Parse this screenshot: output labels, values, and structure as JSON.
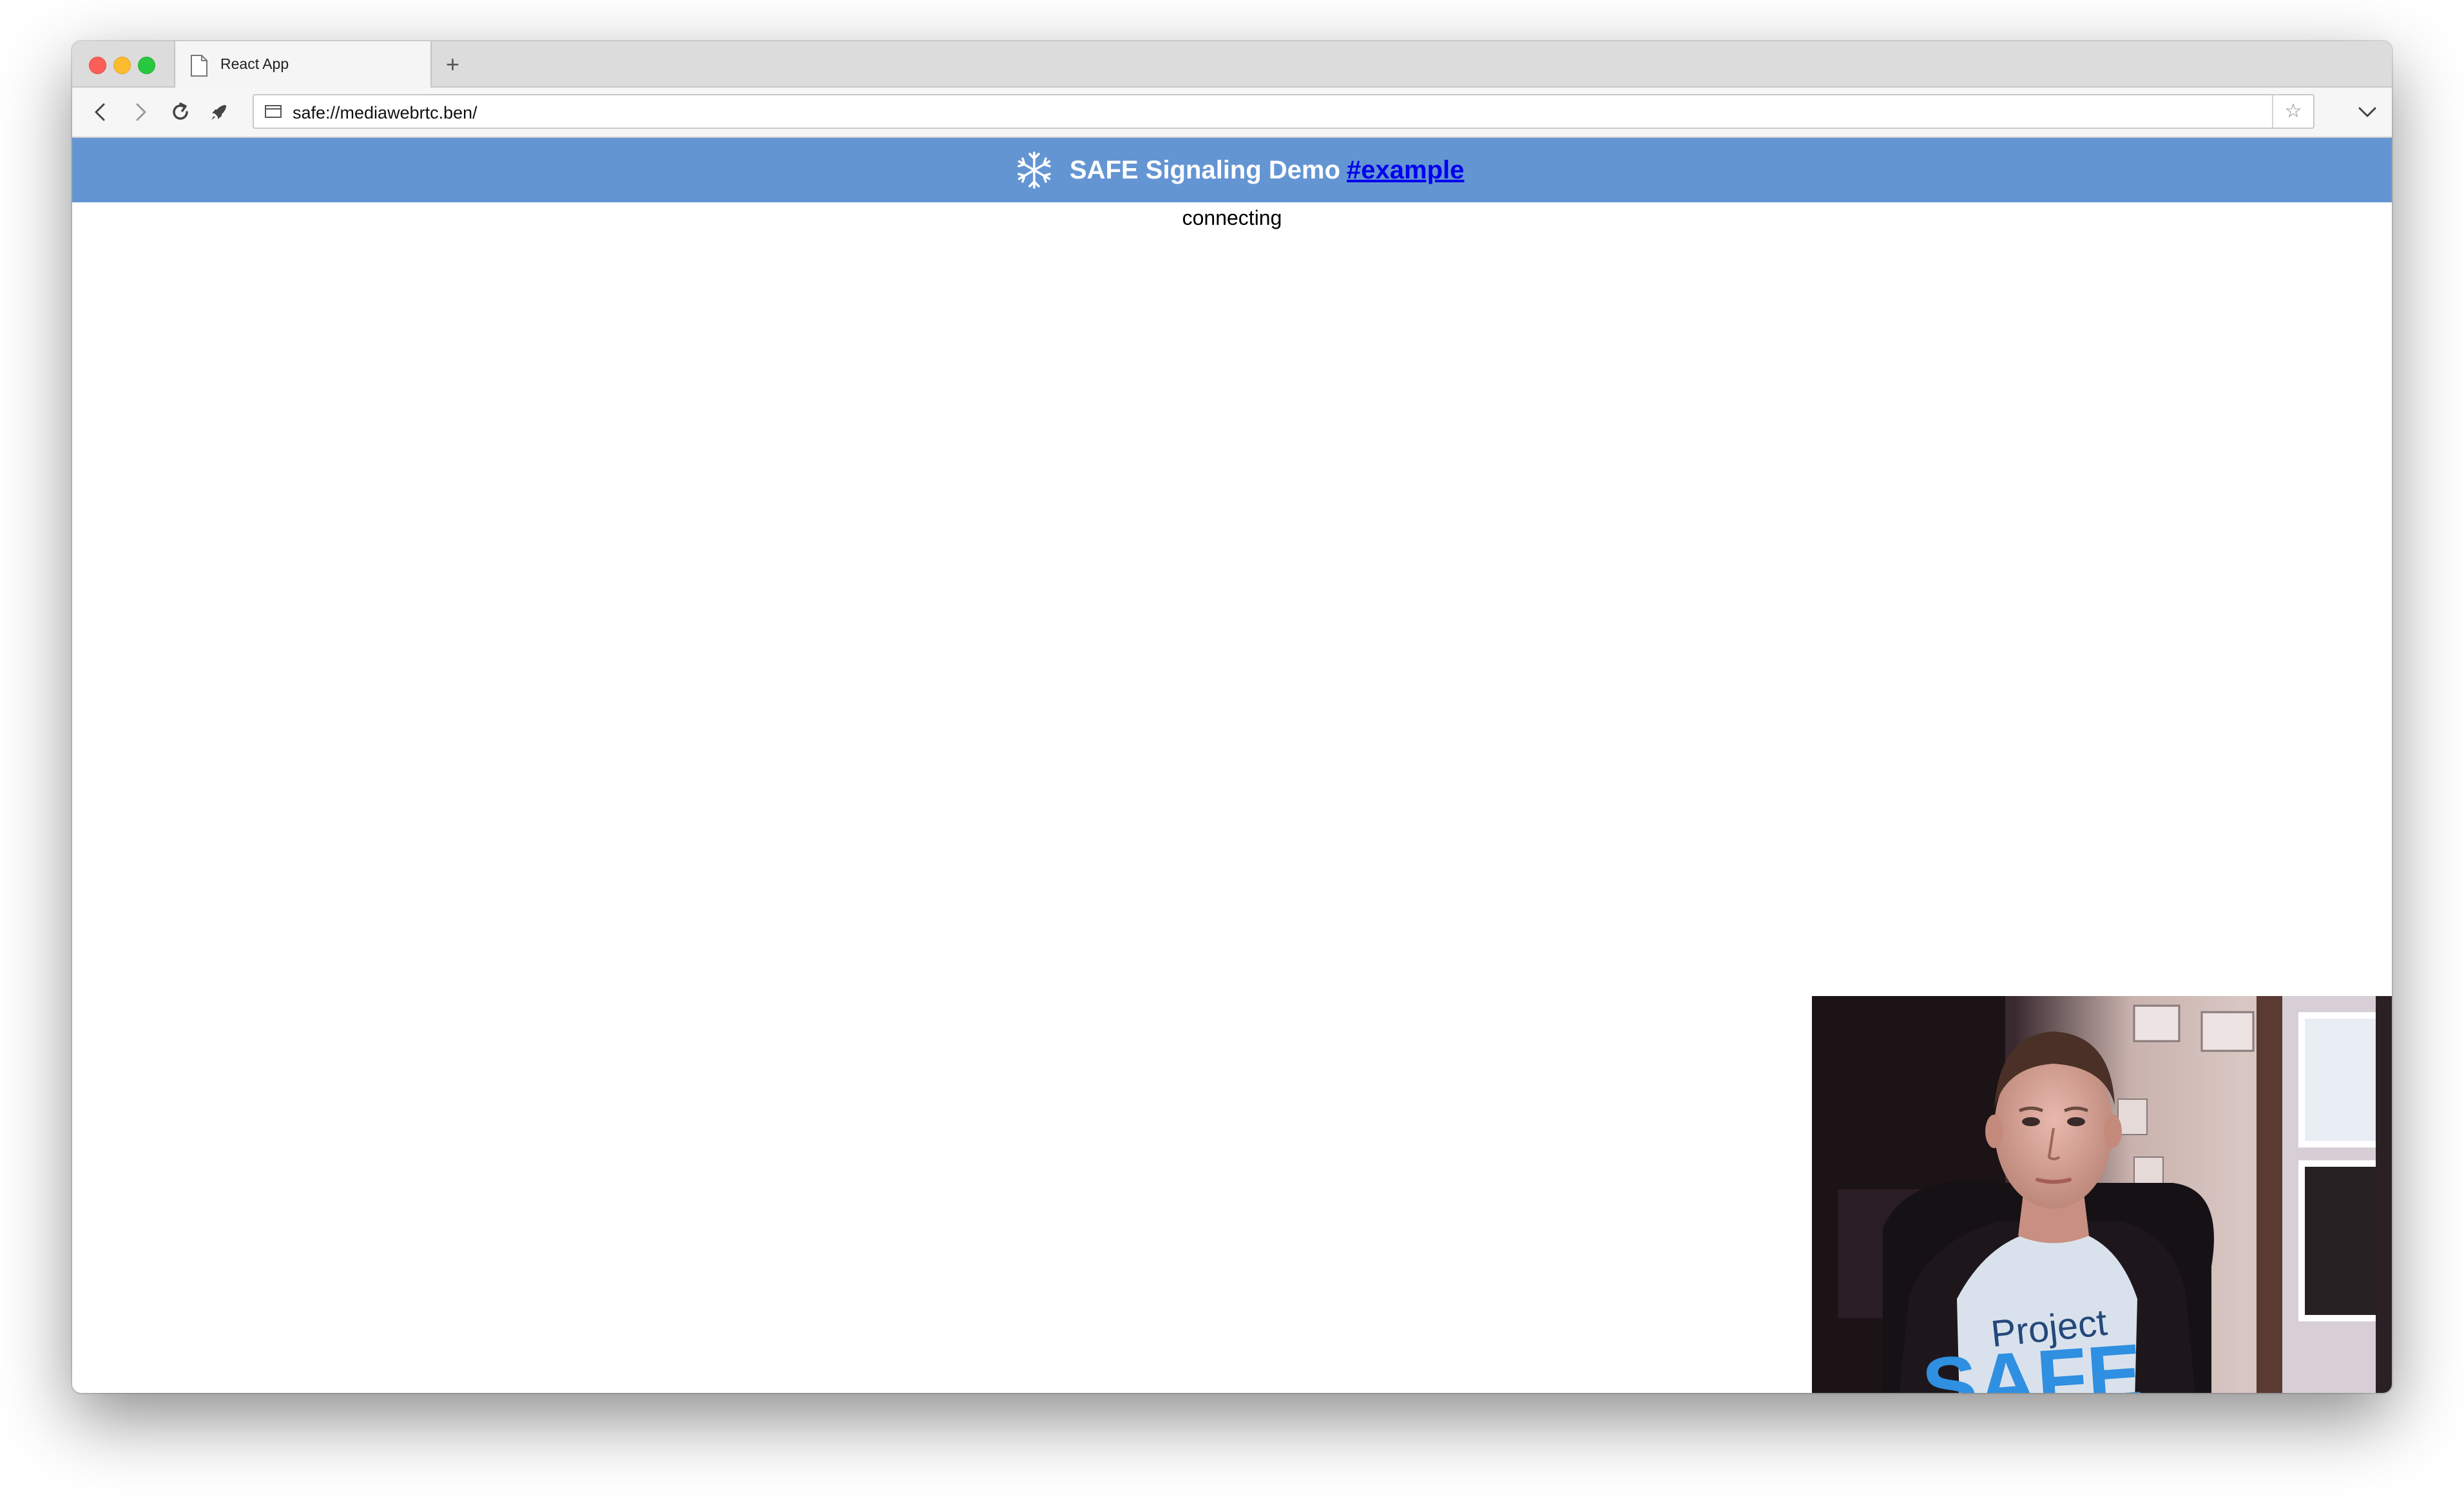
{
  "browser": {
    "tab_title": "React App",
    "new_tab_symbol": "+",
    "address": "safe://mediawebrtc.ben/",
    "bookmark_symbol": "☆"
  },
  "app": {
    "title": "SAFE Signaling Demo",
    "room_link": "#example",
    "status": "connecting",
    "header_color": "#6495d3"
  },
  "video": {
    "shirt_line1": "Project",
    "shirt_line2": "SAFE"
  },
  "icons": [
    "back-icon",
    "forward-icon",
    "reload-icon",
    "rocket-icon",
    "page-icon",
    "star-icon",
    "chevron-down-icon",
    "safe-logo-icon"
  ]
}
